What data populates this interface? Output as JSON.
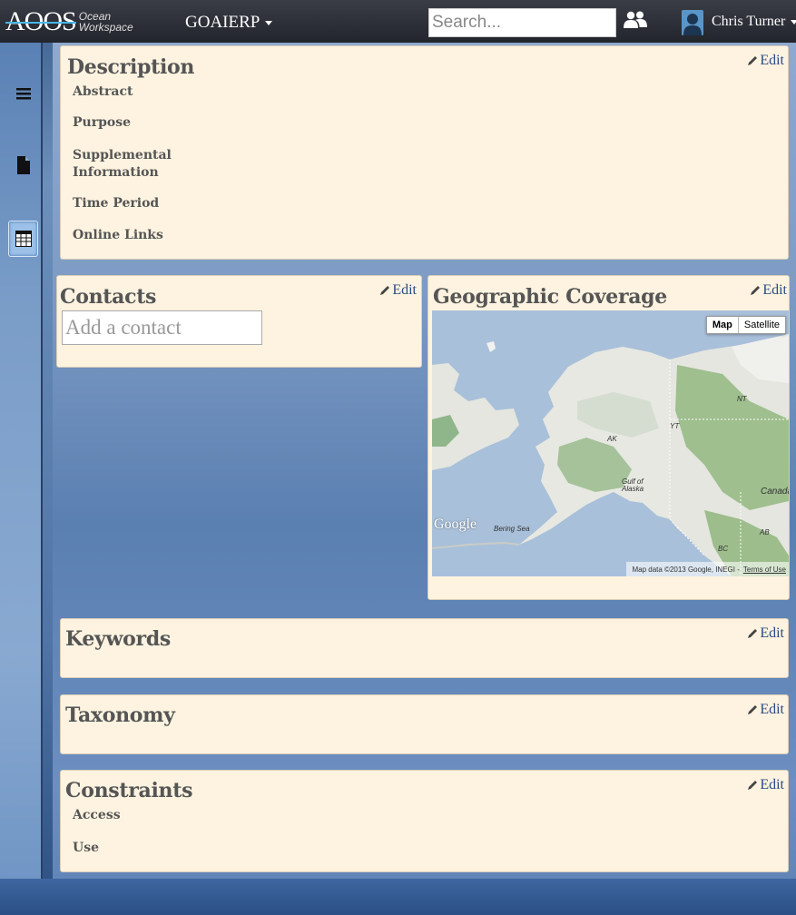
{
  "header": {
    "logo_text": "AOOS",
    "logo_sub_1": "Ocean",
    "logo_sub_2": "Workspace",
    "project": "GOAIERP",
    "search_placeholder": "Search...",
    "user_name": "Chris Turner"
  },
  "sidebar": {
    "items": [
      {
        "icon": "menu-icon"
      },
      {
        "icon": "document-icon"
      },
      {
        "icon": "table-icon",
        "active": true
      }
    ]
  },
  "description": {
    "title": "Description",
    "edit": "Edit",
    "fields": [
      "Abstract",
      "Purpose",
      "Supplemental",
      "Information",
      "Time Period",
      "Online Links"
    ]
  },
  "contacts": {
    "title": "Contacts",
    "edit": "Edit",
    "input_placeholder": "Add a contact"
  },
  "geographic": {
    "title": "Geographic Coverage",
    "edit": "Edit",
    "map_button": "Map",
    "satellite_button": "Satellite",
    "labels": {
      "ak": "AK",
      "yt": "YT",
      "nt": "NT",
      "canada": "Canada",
      "gulf": "Gulf of",
      "alaska": "Alaska",
      "bering": "Bering Sea",
      "ab": "AB",
      "bc": "BC"
    },
    "google": "Google",
    "footer": "Map data ©2013 Google, INEGI -",
    "terms": "Terms of Use"
  },
  "keywords": {
    "title": "Keywords",
    "edit": "Edit"
  },
  "taxonomy": {
    "title": "Taxonomy",
    "edit": "Edit"
  },
  "constraints": {
    "title": "Constraints",
    "edit": "Edit",
    "fields": [
      "Access",
      "Use"
    ]
  },
  "colors": {
    "panel_bg": "#fdf3e0",
    "topbar": "#2b2e36",
    "link": "#2a4a86"
  }
}
